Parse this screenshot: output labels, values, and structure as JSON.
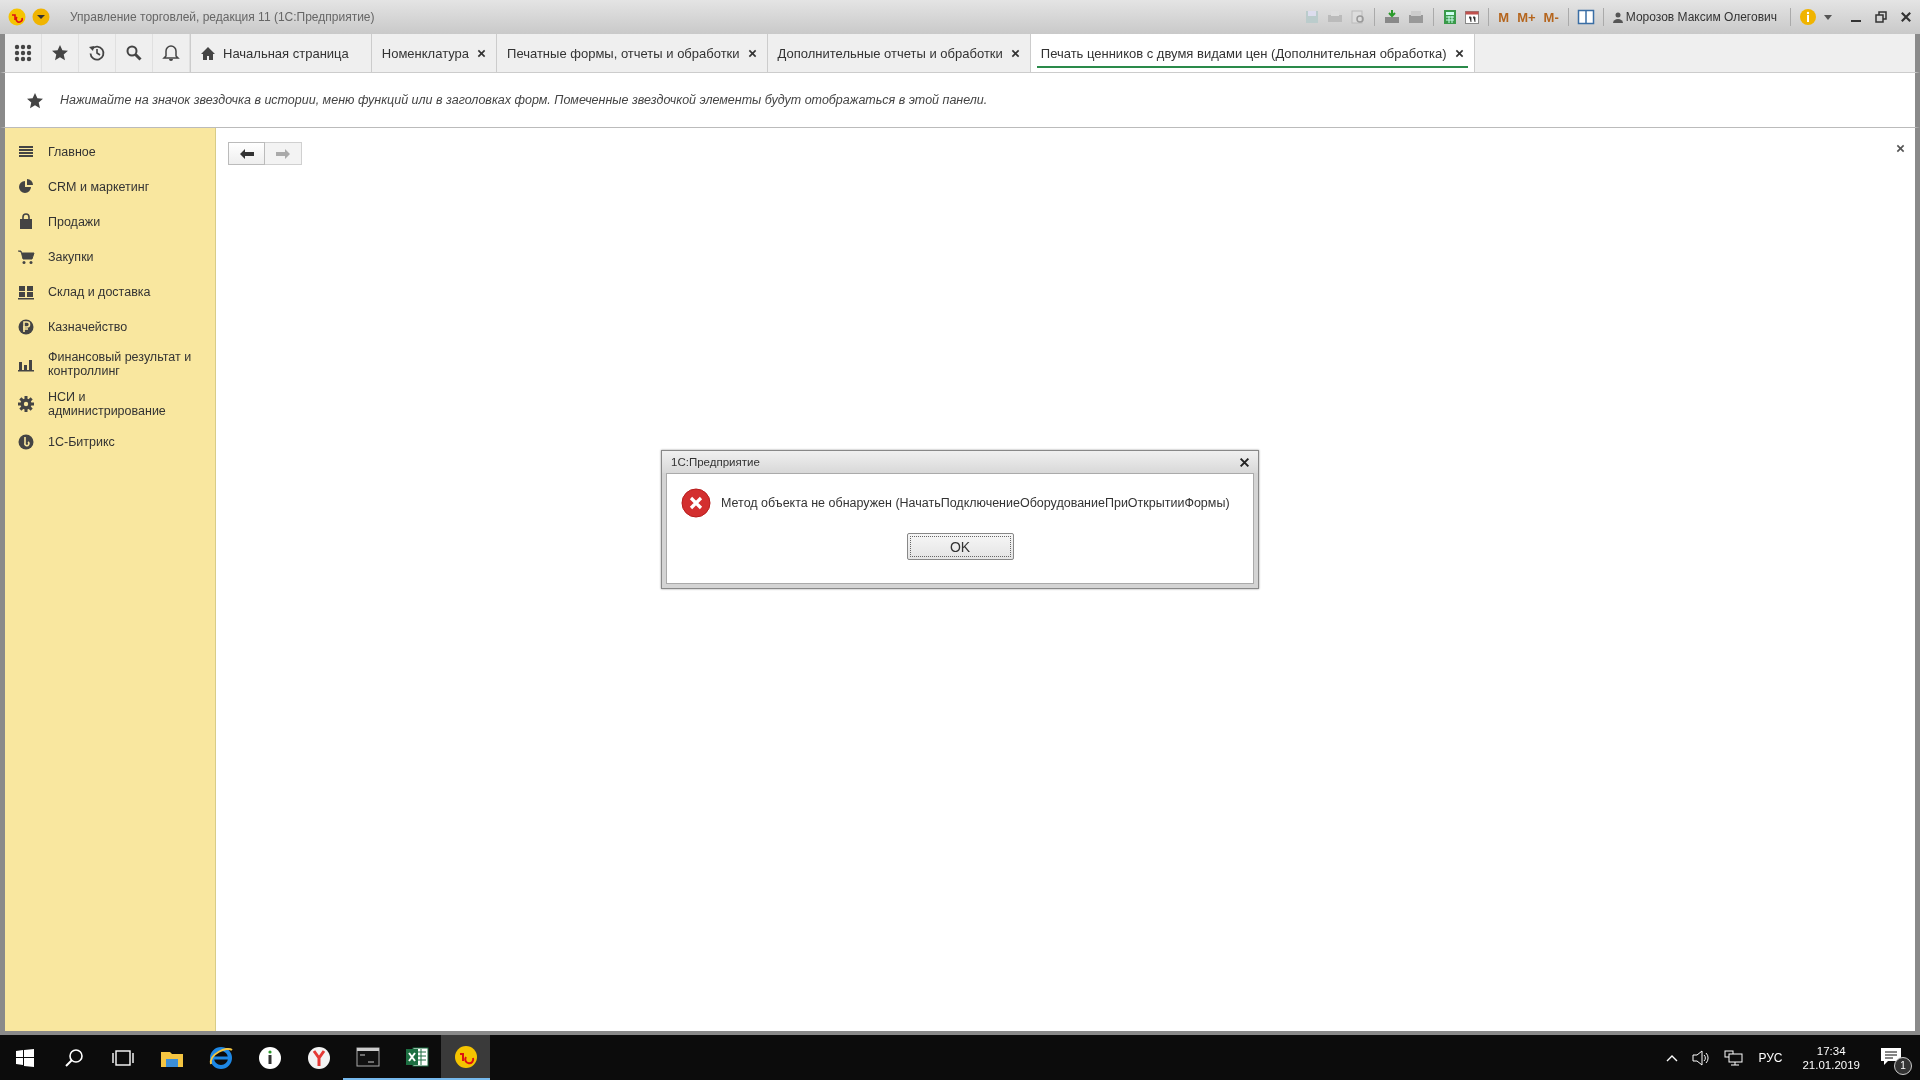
{
  "window": {
    "title": "Управление торговлей, редакция 11  (1С:Предприятие)",
    "memory_buttons": [
      "M",
      "M+",
      "M-"
    ],
    "user": "Морозов Максим Олегович"
  },
  "tabs": [
    {
      "label": "Начальная страница",
      "selected": false,
      "closable": false
    },
    {
      "label": "Номенклатура",
      "selected": false,
      "closable": true
    },
    {
      "label": "Печатные формы, отчеты и обработки",
      "selected": false,
      "closable": true
    },
    {
      "label": "Дополнительные отчеты и обработки",
      "selected": false,
      "closable": true
    },
    {
      "label": "Печать ценников с двумя видами цен (Дополнительная обработка)",
      "selected": true,
      "closable": true
    }
  ],
  "favorites_hint": "Нажимайте на значок звездочка в истории, меню функций или в заголовках форм. Помеченные звездочкой элементы будут отображаться в этой панели.",
  "sidebar": {
    "items": [
      {
        "label": "Главное"
      },
      {
        "label": "CRM и маркетинг"
      },
      {
        "label": "Продажи"
      },
      {
        "label": "Закупки"
      },
      {
        "label": "Склад и доставка"
      },
      {
        "label": "Казначейство"
      },
      {
        "label": "Финансовый результат и контроллинг"
      },
      {
        "label": "НСИ и администрирование"
      },
      {
        "label": "1С-Битрикс"
      }
    ]
  },
  "navigation": {
    "back_disabled": false,
    "forward_disabled": true
  },
  "dialog": {
    "title": "1С:Предприятие",
    "message": "Метод объекта не обнаружен (НачатьПодключениеОборудованиеПриОткрытииФормы)",
    "buttons": [
      "OK"
    ]
  },
  "taskbar": {
    "apps": [
      {
        "running": false,
        "selected": false
      },
      {
        "running": false,
        "selected": false
      },
      {
        "running": false,
        "selected": false
      },
      {
        "running": false,
        "selected": false
      },
      {
        "running": true,
        "selected": false
      },
      {
        "running": true,
        "selected": false
      },
      {
        "running": true,
        "selected": true
      }
    ],
    "language": "РУС",
    "time": "17:34",
    "date": "21.01.2019",
    "notifications": "1"
  }
}
